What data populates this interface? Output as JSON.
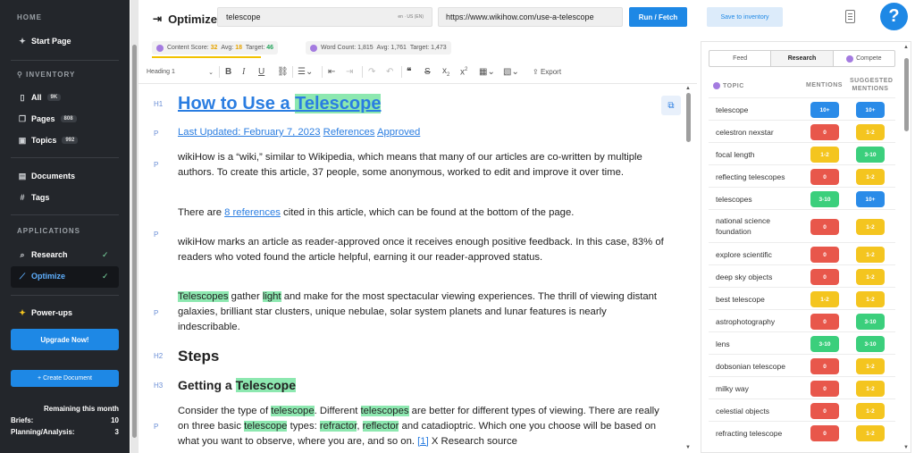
{
  "sidebar": {
    "home_label": "HOME",
    "start_page": "Start Page",
    "inventory_label": "INVENTORY",
    "inventory_items": [
      {
        "label": "All",
        "count": "9K"
      },
      {
        "label": "Pages",
        "count": "808"
      },
      {
        "label": "Topics",
        "count": "992"
      }
    ],
    "documents": "Documents",
    "tags": "Tags",
    "applications_label": "APPLICATIONS",
    "research": "Research",
    "optimize": "Optimize",
    "powerups": "Power-ups",
    "upgrade_button": "Upgrade Now!",
    "create_button": "+ Create Document",
    "remaining_label": "Remaining this month",
    "briefs_label": "Briefs:",
    "briefs_value": "10",
    "planning_label": "Planning/Analysis:",
    "planning_value": "3"
  },
  "header": {
    "title": "Optimize",
    "keyword_value": "telescope",
    "locale": "en · US (EN)",
    "url_value": "https://www.wikihow.com/use-a-telescope",
    "run_button": "Run / Fetch",
    "save_button": "Save to inventory",
    "help": "?"
  },
  "scores": {
    "content_label": "Content Score:",
    "content_value": "32",
    "content_avg_label": "Avg:",
    "content_avg": "18",
    "content_target_label": "Target:",
    "content_target": "46",
    "word_label": "Word Count:",
    "word_value": "1,815",
    "word_avg_label": "Avg:",
    "word_avg": "1,761",
    "word_target_label": "Target:",
    "word_target": "1,473"
  },
  "toolbar": {
    "heading_select": "Heading 1",
    "export": "Export"
  },
  "editor": {
    "tags": {
      "h1": "H1",
      "p": "P",
      "h2": "H2",
      "h3": "H3"
    },
    "h1_pre": "How to Use a ",
    "h1_hl": "Telescope",
    "meta_updated": "Last Updated: February 7, 2023",
    "meta_refs": "References",
    "meta_approved": "Approved",
    "p1": "wikiHow is a “wiki,” similar to Wikipedia, which means that many of our articles are co-written by multiple authors. To create this article, 37 people, some anonymous, worked to edit and improve it over time.",
    "p2_pre": "There are ",
    "p2_link": "8 references",
    "p2_post": " cited in this article, which can be found at the bottom of the page.",
    "p3": "wikiHow marks an article as reader-approved once it receives enough positive feedback. In this case, 83% of readers who voted found the article helpful, earning it our reader-approved status.",
    "p4_hl1": "Telescopes",
    "p4_a": " gather ",
    "p4_hl2": "light",
    "p4_b": " and make for the most spectacular viewing experiences. The thrill of viewing distant galaxies, brilliant star clusters, unique nebulae, solar system planets and lunar features is nearly indescribable.",
    "h2": "Steps",
    "h3_pre": "Getting a ",
    "h3_hl": "Telescope",
    "p5_a": "Consider the type of ",
    "p5_hl1": "telescope",
    "p5_b": ". Different ",
    "p5_hl2": "telescopes",
    "p5_c": " are better for different types of viewing. There are really on three basic ",
    "p5_hl3": "telescope",
    "p5_d": " types: ",
    "p5_hl4": "refractor",
    "p5_e": ", ",
    "p5_hl5": "reflector",
    "p5_f": " and catadioptric. Which one you choose will be based on what you want to observe, where you are, and so on. ",
    "p5_link": "[1]",
    "p5_g": " X Research source"
  },
  "panel": {
    "tabs": [
      "Feed",
      "Research",
      "Compete"
    ],
    "col_topic": "TOPIC",
    "col_mentions": "MENTIONS",
    "col_suggested": "SUGGESTED MENTIONS",
    "rows": [
      {
        "topic": "telescope",
        "mentions": "10+",
        "m_color": "#2a8be8",
        "suggested": "10+",
        "s_color": "#2a8be8"
      },
      {
        "topic": "celestron nexstar",
        "mentions": "0",
        "m_color": "#e8574b",
        "suggested": "1-2",
        "s_color": "#f4c51f"
      },
      {
        "topic": "focal length",
        "mentions": "1-2",
        "m_color": "#f4c51f",
        "suggested": "3-10",
        "s_color": "#3bcf7c"
      },
      {
        "topic": "reflecting telescopes",
        "mentions": "0",
        "m_color": "#e8574b",
        "suggested": "1-2",
        "s_color": "#f4c51f"
      },
      {
        "topic": "telescopes",
        "mentions": "3-10",
        "m_color": "#3bcf7c",
        "suggested": "10+",
        "s_color": "#2a8be8"
      },
      {
        "topic": "national science foundation",
        "mentions": "0",
        "m_color": "#e8574b",
        "suggested": "1-2",
        "s_color": "#f4c51f"
      },
      {
        "topic": "explore scientific",
        "mentions": "0",
        "m_color": "#e8574b",
        "suggested": "1-2",
        "s_color": "#f4c51f"
      },
      {
        "topic": "deep sky objects",
        "mentions": "0",
        "m_color": "#e8574b",
        "suggested": "1-2",
        "s_color": "#f4c51f"
      },
      {
        "topic": "best telescope",
        "mentions": "1-2",
        "m_color": "#f4c51f",
        "suggested": "1-2",
        "s_color": "#f4c51f"
      },
      {
        "topic": "astrophotography",
        "mentions": "0",
        "m_color": "#e8574b",
        "suggested": "3-10",
        "s_color": "#3bcf7c"
      },
      {
        "topic": "lens",
        "mentions": "3-10",
        "m_color": "#3bcf7c",
        "suggested": "3-10",
        "s_color": "#3bcf7c"
      },
      {
        "topic": "dobsonian telescope",
        "mentions": "0",
        "m_color": "#e8574b",
        "suggested": "1-2",
        "s_color": "#f4c51f"
      },
      {
        "topic": "milky way",
        "mentions": "0",
        "m_color": "#e8574b",
        "suggested": "1-2",
        "s_color": "#f4c51f"
      },
      {
        "topic": "celestial objects",
        "mentions": "0",
        "m_color": "#e8574b",
        "suggested": "1-2",
        "s_color": "#f4c51f"
      },
      {
        "topic": "refracting telescope",
        "mentions": "0",
        "m_color": "#e8574b",
        "suggested": "1-2",
        "s_color": "#f4c51f"
      }
    ]
  }
}
